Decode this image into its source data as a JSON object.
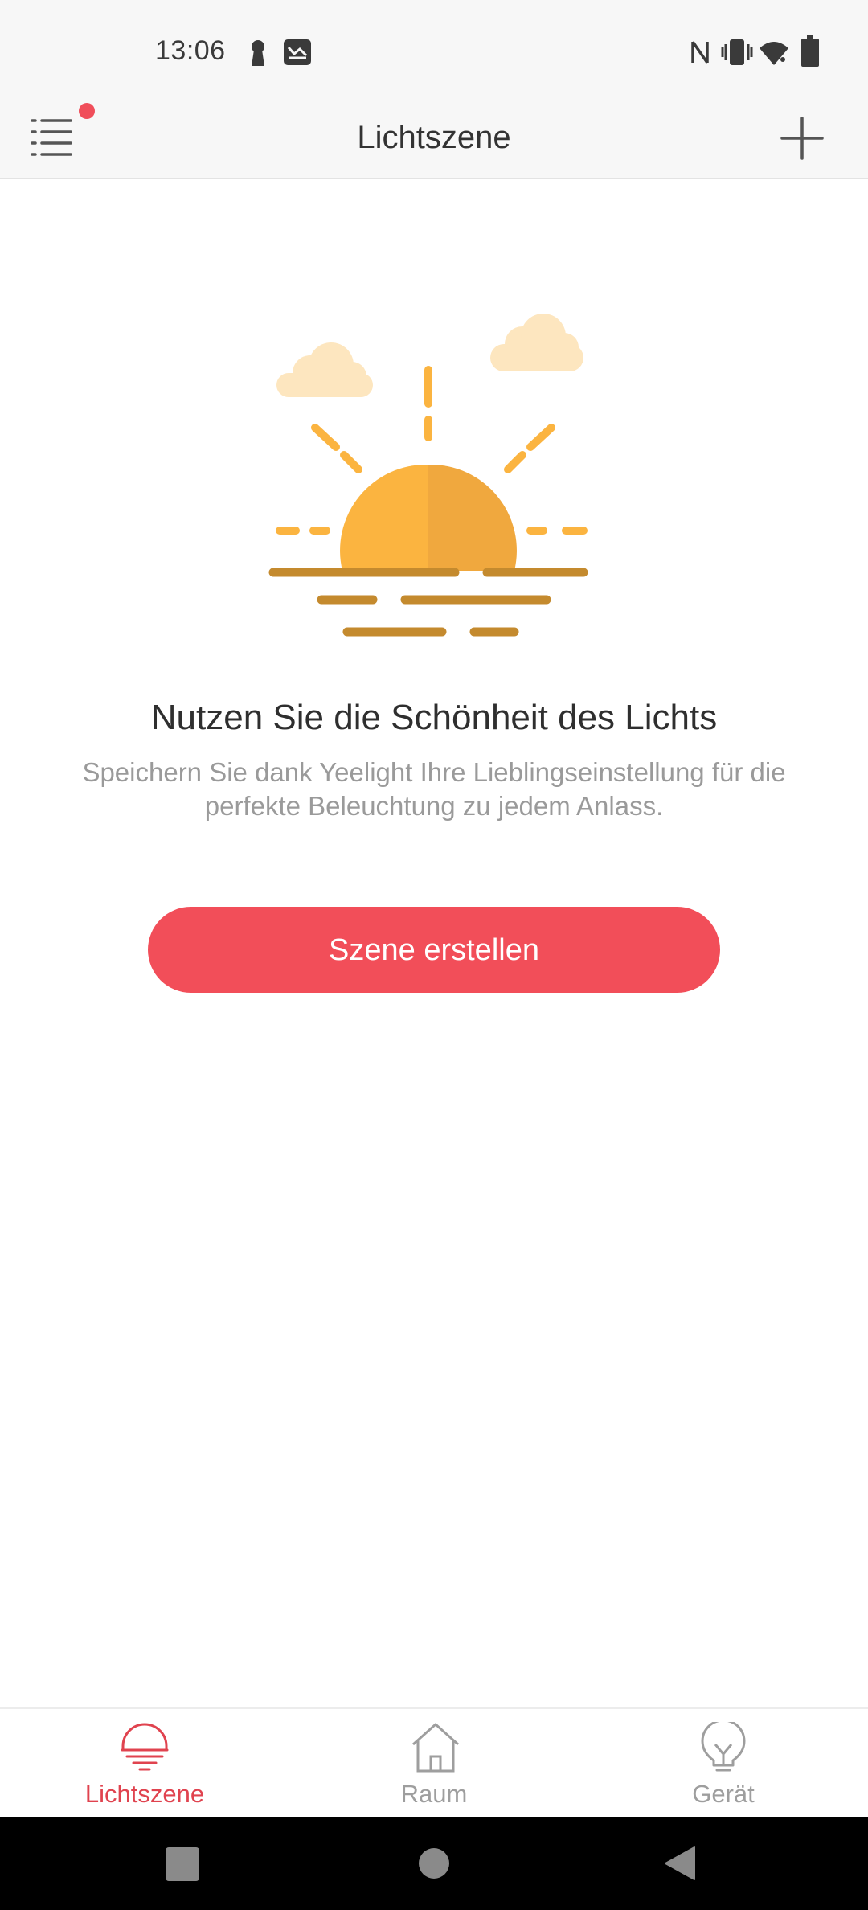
{
  "status_bar": {
    "time": "13:06",
    "icons": [
      "keyhole-icon",
      "mail-icon",
      "nfc-icon",
      "vibrate-icon",
      "wifi-icon",
      "battery-icon"
    ]
  },
  "header": {
    "title": "Lichtszene",
    "menu_icon": "menu-icon",
    "add_icon": "plus-icon",
    "notification_dot": true
  },
  "empty_state": {
    "illustration": "sunset-illustration",
    "headline": "Nutzen Sie die Schönheit des Lichts",
    "description": "Speichern Sie dank Yeelight Ihre Lieblingseinstellung für die perfekte Beleuchtung zu jedem Anlass.",
    "button_label": "Szene erstellen"
  },
  "bottom_nav": {
    "items": [
      {
        "label": "Lichtszene",
        "icon": "sunset-icon",
        "active": true
      },
      {
        "label": "Raum",
        "icon": "house-icon",
        "active": false
      },
      {
        "label": "Gerät",
        "icon": "bulb-icon",
        "active": false
      }
    ]
  },
  "system_nav": {
    "buttons": [
      "recents-icon",
      "home-icon",
      "back-icon"
    ]
  },
  "colors": {
    "accent": "#f24e59",
    "nav_active": "#e0434f",
    "nav_inactive": "#9e9e9e",
    "sun_light": "#fbb440",
    "sun_dark": "#f0a83e",
    "horizon": "#c48a2e",
    "cloud": "#fde6bf"
  }
}
